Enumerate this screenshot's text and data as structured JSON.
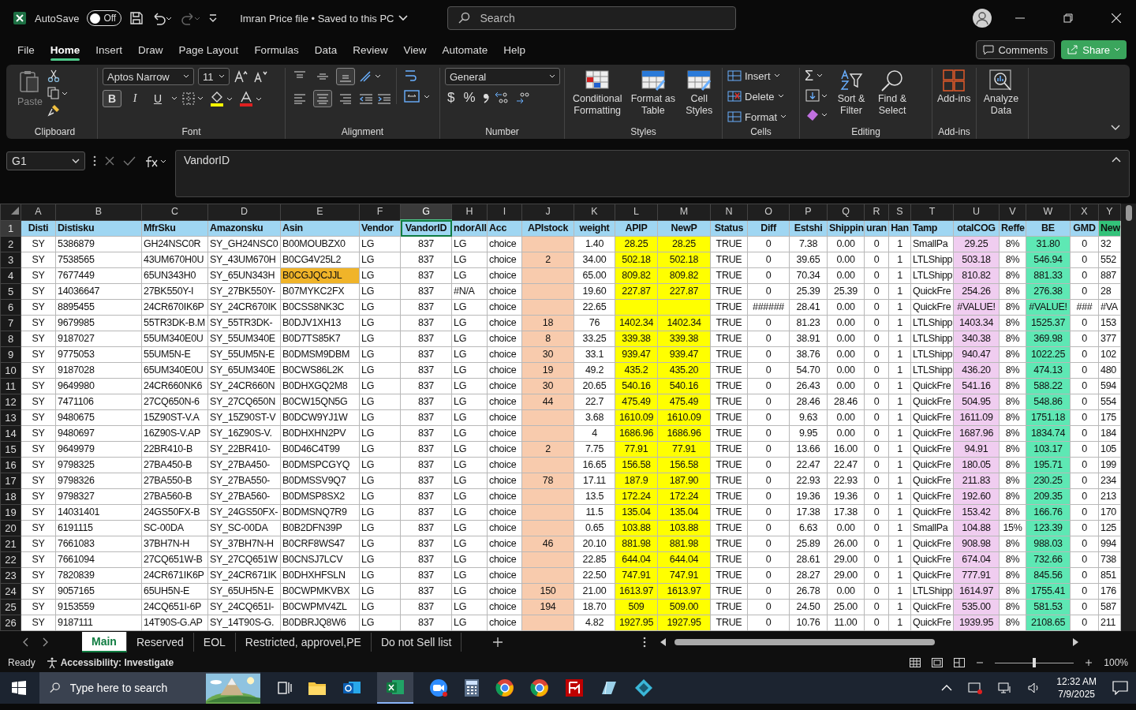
{
  "title_bar": {
    "autosave_label": "AutoSave",
    "autosave": {
      "on": false,
      "label": "Off"
    },
    "document_title": "Imran Price file • Saved to this PC",
    "search": {
      "placeholder": "Search"
    }
  },
  "menu_tabs": [
    {
      "label": "File",
      "selected": false
    },
    {
      "label": "Home",
      "selected": true
    },
    {
      "label": "Insert",
      "selected": false
    },
    {
      "label": "Draw",
      "selected": false
    },
    {
      "label": "Page Layout",
      "selected": false
    },
    {
      "label": "Formulas",
      "selected": false
    },
    {
      "label": "Data",
      "selected": false
    },
    {
      "label": "Review",
      "selected": false
    },
    {
      "label": "View",
      "selected": false
    },
    {
      "label": "Automate",
      "selected": false
    },
    {
      "label": "Help",
      "selected": false
    }
  ],
  "comments_label": "Comments",
  "share_label": "Share",
  "ribbon": [
    {
      "kind": "clipboard",
      "label": "Clipboard",
      "paste": "Paste"
    },
    {
      "kind": "font",
      "label": "Font",
      "font_name": "Aptos Narrow",
      "font_size": "11",
      "style_buttons": [
        {
          "label": "B",
          "selected": true
        },
        {
          "label": "I",
          "selected": false
        },
        {
          "label": "U",
          "selected": false
        }
      ]
    },
    {
      "kind": "alignment",
      "label": "Alignment",
      "vertical_align": [
        {
          "selected": false
        },
        {
          "selected": false
        },
        {
          "selected": true
        }
      ],
      "horizontal_align": [
        {
          "selected": false
        },
        {
          "selected": true
        },
        {
          "selected": false
        }
      ]
    },
    {
      "kind": "number",
      "label": "Number",
      "format": "General",
      "symbols": [
        "$",
        "%"
      ]
    },
    {
      "kind": "styles",
      "label": "Styles",
      "buttons": [
        "Conditional Formatting",
        "Format as Table",
        "Cell Styles"
      ]
    },
    {
      "kind": "cells",
      "label": "Cells",
      "buttons": [
        "Insert",
        "Delete",
        "Format"
      ]
    },
    {
      "kind": "editing",
      "label": "Editing",
      "symbol": "Σ",
      "buttons": [
        "Sort & Filter",
        "Find & Select"
      ]
    },
    {
      "kind": "addins",
      "label": "Add-ins",
      "buttons": [
        "Add-ins"
      ]
    },
    {
      "kind": "analyze",
      "buttons": [
        "Analyze Data"
      ]
    }
  ],
  "formula_bar": {
    "name_box": "G1",
    "formula": "VandorID"
  },
  "sheet": {
    "header_row_num": "1",
    "header_row": [
      {
        "text": "Disti"
      },
      {
        "text": "Distisku"
      },
      {
        "text": "MfrSku"
      },
      {
        "text": "Amazonsku"
      },
      {
        "text": "Asin"
      },
      {
        "text": "Vendor"
      },
      {
        "text": "VandorID"
      },
      {
        "text": "ndorAll"
      },
      {
        "text": "Acc"
      },
      {
        "text": "APIstock"
      },
      {
        "text": "weight"
      },
      {
        "text": "APIP"
      },
      {
        "text": "NewP"
      },
      {
        "text": "Status"
      },
      {
        "text": "Diff"
      },
      {
        "text": "Estshi"
      },
      {
        "text": "Shippin"
      },
      {
        "text": "uran"
      },
      {
        "text": "Han"
      },
      {
        "text": "Tamp"
      },
      {
        "text": "otalCOG"
      },
      {
        "text": "Reffe"
      },
      {
        "text": "BE"
      },
      {
        "text": "GMD"
      },
      {
        "text": "New",
        "color": "#33c27a"
      }
    ],
    "columns": [
      {
        "letter": "A",
        "selected": false
      },
      {
        "letter": "B",
        "selected": false
      },
      {
        "letter": "C",
        "selected": false
      },
      {
        "letter": "D",
        "selected": false
      },
      {
        "letter": "E",
        "selected": false
      },
      {
        "letter": "F",
        "selected": false
      },
      {
        "letter": "G",
        "selected": true
      },
      {
        "letter": "H",
        "selected": false
      },
      {
        "letter": "I",
        "selected": false
      },
      {
        "letter": "J",
        "selected": false,
        "color": "#f8cbad"
      },
      {
        "letter": "K",
        "selected": false
      },
      {
        "letter": "L",
        "selected": false,
        "color": "#ffff00"
      },
      {
        "letter": "M",
        "selected": false,
        "color": "#ffff00"
      },
      {
        "letter": "N",
        "selected": false
      },
      {
        "letter": "O",
        "selected": false
      },
      {
        "letter": "P",
        "selected": false
      },
      {
        "letter": "Q",
        "selected": false
      },
      {
        "letter": "R",
        "selected": false
      },
      {
        "letter": "S",
        "selected": false
      },
      {
        "letter": "T",
        "selected": false
      },
      {
        "letter": "U",
        "selected": false,
        "color": "#f0cdf0"
      },
      {
        "letter": "V",
        "selected": false
      },
      {
        "letter": "W",
        "selected": false,
        "color": "#5ee8b4"
      },
      {
        "letter": "X",
        "selected": false
      },
      {
        "letter": "Y",
        "selected": false
      }
    ],
    "rows": [
      {
        "num": "2",
        "asin_flagged": false,
        "cells": [
          "SY",
          "5386879",
          "GH24NSC0R",
          "SY_GH24NSC0",
          "B00MOUBZX0",
          "LG",
          "837",
          "LG",
          "choice",
          null,
          "1.40",
          "28.25",
          "28.25",
          "TRUE",
          "0",
          "7.38",
          "0.00",
          "0",
          "1",
          "SmallPa",
          "29.25",
          "8%",
          "31.80",
          "0",
          "32"
        ]
      },
      {
        "num": "3",
        "asin_flagged": false,
        "cells": [
          "SY",
          "7538565",
          "43UM670H0U",
          "SY_43UM670H",
          "B0CG4V25L2",
          "LG",
          "837",
          "LG",
          "choice",
          "2",
          "34.00",
          "502.18",
          "502.18",
          "TRUE",
          "0",
          "39.65",
          "0.00",
          "0",
          "1",
          "LTLShipp",
          "503.18",
          "8%",
          "546.94",
          "0",
          "552"
        ]
      },
      {
        "num": "4",
        "asin_flagged": true,
        "cells": [
          "SY",
          "7677449",
          "65UN343H0",
          "SY_65UN343H",
          "B0CGJQCJJL",
          "LG",
          "837",
          "LG",
          "choice",
          null,
          "65.00",
          "809.82",
          "809.82",
          "TRUE",
          "0",
          "70.34",
          "0.00",
          "0",
          "1",
          "LTLShipp",
          "810.82",
          "8%",
          "881.33",
          "0",
          "887"
        ]
      },
      {
        "num": "5",
        "asin_flagged": false,
        "cells": [
          "SY",
          "14036647",
          "27BK550Y-I",
          "SY_27BK550Y-",
          "B07MYKC2FX",
          "LG",
          "837",
          "#N/A",
          "choice",
          null,
          "19.60",
          "227.87",
          "227.87",
          "TRUE",
          "0",
          "25.39",
          "25.39",
          "0",
          "1",
          "QuickFre",
          "254.26",
          "8%",
          "276.38",
          "0",
          "28"
        ]
      },
      {
        "num": "6",
        "asin_flagged": false,
        "cells": [
          "SY",
          "8895455",
          "24CR670IK6P",
          "SY_24CR670IK",
          "B0CSS8NK3C",
          "LG",
          "837",
          "LG",
          "choice",
          null,
          "22.65",
          null,
          null,
          "TRUE",
          "######",
          "28.41",
          "0.00",
          "0",
          "1",
          "QuickFre",
          "#VALUE!",
          "8%",
          "#VALUE!",
          "###",
          "#VA"
        ]
      },
      {
        "num": "7",
        "asin_flagged": false,
        "cells": [
          "SY",
          "9679985",
          "55TR3DK-B.M",
          "SY_55TR3DK-",
          "B0DJV1XH13",
          "LG",
          "837",
          "LG",
          "choice",
          "18",
          "76",
          "1402.34",
          "1402.34",
          "TRUE",
          "0",
          "81.23",
          "0.00",
          "0",
          "1",
          "LTLShipp",
          "1403.34",
          "8%",
          "1525.37",
          "0",
          "153"
        ]
      },
      {
        "num": "8",
        "asin_flagged": false,
        "cells": [
          "SY",
          "9187027",
          "55UM340E0U",
          "SY_55UM340E",
          "B0D7TS85K7",
          "LG",
          "837",
          "LG",
          "choice",
          "8",
          "33.25",
          "339.38",
          "339.38",
          "TRUE",
          "0",
          "38.91",
          "0.00",
          "0",
          "1",
          "LTLShipp",
          "340.38",
          "8%",
          "369.98",
          "0",
          "377"
        ]
      },
      {
        "num": "9",
        "asin_flagged": false,
        "cells": [
          "SY",
          "9775053",
          "55UM5N-E",
          "SY_55UM5N-E",
          "B0DMSM9DBM",
          "LG",
          "837",
          "LG",
          "choice",
          "30",
          "33.1",
          "939.47",
          "939.47",
          "TRUE",
          "0",
          "38.76",
          "0.00",
          "0",
          "1",
          "LTLShipp",
          "940.47",
          "8%",
          "1022.25",
          "0",
          "102"
        ]
      },
      {
        "num": "10",
        "asin_flagged": false,
        "cells": [
          "SY",
          "9187028",
          "65UM340E0U",
          "SY_65UM340E",
          "B0CWS86L2K",
          "LG",
          "837",
          "LG",
          "choice",
          "19",
          "49.2",
          "435.2",
          "435.20",
          "TRUE",
          "0",
          "54.70",
          "0.00",
          "0",
          "1",
          "LTLShipp",
          "436.20",
          "8%",
          "474.13",
          "0",
          "480"
        ]
      },
      {
        "num": "11",
        "asin_flagged": false,
        "cells": [
          "SY",
          "9649980",
          "24CR660NK6",
          "SY_24CR660N",
          "B0DHXGQ2M8",
          "LG",
          "837",
          "LG",
          "choice",
          "30",
          "20.65",
          "540.16",
          "540.16",
          "TRUE",
          "0",
          "26.43",
          "0.00",
          "0",
          "1",
          "QuickFre",
          "541.16",
          "8%",
          "588.22",
          "0",
          "594"
        ]
      },
      {
        "num": "12",
        "asin_flagged": false,
        "cells": [
          "SY",
          "7471106",
          "27CQ650N-6",
          "SY_27CQ650N",
          "B0CW15QN5G",
          "LG",
          "837",
          "LG",
          "choice",
          "44",
          "22.7",
          "475.49",
          "475.49",
          "TRUE",
          "0",
          "28.46",
          "28.46",
          "0",
          "1",
          "QuickFre",
          "504.95",
          "8%",
          "548.86",
          "0",
          "554"
        ]
      },
      {
        "num": "13",
        "asin_flagged": false,
        "cells": [
          "SY",
          "9480675",
          "15Z90ST-V.A",
          "SY_15Z90ST-V",
          "B0DCW9YJ1W",
          "LG",
          "837",
          "LG",
          "choice",
          null,
          "3.68",
          "1610.09",
          "1610.09",
          "TRUE",
          "0",
          "9.63",
          "0.00",
          "0",
          "1",
          "QuickFre",
          "1611.09",
          "8%",
          "1751.18",
          "0",
          "175"
        ]
      },
      {
        "num": "14",
        "asin_flagged": false,
        "cells": [
          "SY",
          "9480697",
          "16Z90S-V.AP",
          "SY_16Z90S-V.",
          "B0DHXHN2PV",
          "LG",
          "837",
          "LG",
          "choice",
          null,
          "4",
          "1686.96",
          "1686.96",
          "TRUE",
          "0",
          "9.95",
          "0.00",
          "0",
          "1",
          "QuickFre",
          "1687.96",
          "8%",
          "1834.74",
          "0",
          "184"
        ]
      },
      {
        "num": "15",
        "asin_flagged": false,
        "cells": [
          "SY",
          "9649979",
          "22BR410-B",
          "SY_22BR410-",
          "B0D46C4T99",
          "LG",
          "837",
          "LG",
          "choice",
          "2",
          "7.75",
          "77.91",
          "77.91",
          "TRUE",
          "0",
          "13.66",
          "16.00",
          "0",
          "1",
          "QuickFre",
          "94.91",
          "8%",
          "103.17",
          "0",
          "105"
        ]
      },
      {
        "num": "16",
        "asin_flagged": false,
        "cells": [
          "SY",
          "9798325",
          "27BA450-B",
          "SY_27BA450-",
          "B0DMSPCGYQ",
          "LG",
          "837",
          "LG",
          "choice",
          null,
          "16.65",
          "156.58",
          "156.58",
          "TRUE",
          "0",
          "22.47",
          "22.47",
          "0",
          "1",
          "QuickFre",
          "180.05",
          "8%",
          "195.71",
          "0",
          "199"
        ]
      },
      {
        "num": "17",
        "asin_flagged": false,
        "cells": [
          "SY",
          "9798326",
          "27BA550-B",
          "SY_27BA550-",
          "B0DMSSV9Q7",
          "LG",
          "837",
          "LG",
          "choice",
          "78",
          "17.11",
          "187.9",
          "187.90",
          "TRUE",
          "0",
          "22.93",
          "22.93",
          "0",
          "1",
          "QuickFre",
          "211.83",
          "8%",
          "230.25",
          "0",
          "234"
        ]
      },
      {
        "num": "18",
        "asin_flagged": false,
        "cells": [
          "SY",
          "9798327",
          "27BA560-B",
          "SY_27BA560-",
          "B0DMSP8SX2",
          "LG",
          "837",
          "LG",
          "choice",
          null,
          "13.5",
          "172.24",
          "172.24",
          "TRUE",
          "0",
          "19.36",
          "19.36",
          "0",
          "1",
          "QuickFre",
          "192.60",
          "8%",
          "209.35",
          "0",
          "213"
        ]
      },
      {
        "num": "19",
        "asin_flagged": false,
        "cells": [
          "SY",
          "14031401",
          "24GS50FX-B",
          "SY_24GS50FX-",
          "B0DMSNQ7R9",
          "LG",
          "837",
          "LG",
          "choice",
          null,
          "11.5",
          "135.04",
          "135.04",
          "TRUE",
          "0",
          "17.38",
          "17.38",
          "0",
          "1",
          "QuickFre",
          "153.42",
          "8%",
          "166.76",
          "0",
          "170"
        ]
      },
      {
        "num": "20",
        "asin_flagged": false,
        "cells": [
          "SY",
          "6191115",
          "SC-00DA",
          "SY_SC-00DA",
          "B0B2DFN39P",
          "LG",
          "837",
          "LG",
          "choice",
          null,
          "0.65",
          "103.88",
          "103.88",
          "TRUE",
          "0",
          "6.63",
          "0.00",
          "0",
          "1",
          "SmallPa",
          "104.88",
          "15%",
          "123.39",
          "0",
          "125"
        ]
      },
      {
        "num": "21",
        "asin_flagged": false,
        "cells": [
          "SY",
          "7661083",
          "37BH7N-H",
          "SY_37BH7N-H",
          "B0CRF8WS47",
          "LG",
          "837",
          "LG",
          "choice",
          "46",
          "20.10",
          "881.98",
          "881.98",
          "TRUE",
          "0",
          "25.89",
          "26.00",
          "0",
          "1",
          "QuickFre",
          "908.98",
          "8%",
          "988.03",
          "0",
          "994"
        ]
      },
      {
        "num": "22",
        "asin_flagged": false,
        "cells": [
          "SY",
          "7661094",
          "27CQ651W-B",
          "SY_27CQ651W",
          "B0CNSJ7LCV",
          "LG",
          "837",
          "LG",
          "choice",
          null,
          "22.85",
          "644.04",
          "644.04",
          "TRUE",
          "0",
          "28.61",
          "29.00",
          "0",
          "1",
          "QuickFre",
          "674.04",
          "8%",
          "732.66",
          "0",
          "738"
        ]
      },
      {
        "num": "23",
        "asin_flagged": false,
        "cells": [
          "SY",
          "7820839",
          "24CR671IK6P",
          "SY_24CR671IK",
          "B0DHXHFSLN",
          "LG",
          "837",
          "LG",
          "choice",
          null,
          "22.50",
          "747.91",
          "747.91",
          "TRUE",
          "0",
          "28.27",
          "29.00",
          "0",
          "1",
          "QuickFre",
          "777.91",
          "8%",
          "845.56",
          "0",
          "851"
        ]
      },
      {
        "num": "24",
        "asin_flagged": false,
        "cells": [
          "SY",
          "9057165",
          "65UH5N-E",
          "SY_65UH5N-E",
          "B0CWPMKVBX",
          "LG",
          "837",
          "LG",
          "choice",
          "150",
          "21.00",
          "1613.97",
          "1613.97",
          "TRUE",
          "0",
          "26.78",
          "0.00",
          "0",
          "1",
          "LTLShipp",
          "1614.97",
          "8%",
          "1755.41",
          "0",
          "176"
        ]
      },
      {
        "num": "25",
        "asin_flagged": false,
        "cells": [
          "SY",
          "9153559",
          "24CQ651I-6P",
          "SY_24CQ651I-",
          "B0CWPMV4ZL",
          "LG",
          "837",
          "LG",
          "choice",
          "194",
          "18.70",
          "509",
          "509.00",
          "TRUE",
          "0",
          "24.50",
          "25.00",
          "0",
          "1",
          "QuickFre",
          "535.00",
          "8%",
          "581.53",
          "0",
          "587"
        ]
      },
      {
        "num": "26",
        "asin_flagged": false,
        "cells": [
          "SY",
          "9187111",
          "14T90S-G.AP",
          "SY_14T90S-G.",
          "B0DBRJQ8W6",
          "LG",
          "837",
          "LG",
          "choice",
          null,
          "4.82",
          "1927.95",
          "1927.95",
          "TRUE",
          "0",
          "10.76",
          "11.00",
          "0",
          "1",
          "QuickFre",
          "1939.95",
          "8%",
          "2108.65",
          "0",
          "211"
        ]
      }
    ]
  },
  "sheet_tabs": [
    {
      "label": "Main",
      "selected": true
    },
    {
      "label": "Reserved",
      "selected": false
    },
    {
      "label": "EOL",
      "selected": false
    },
    {
      "label": "Restricted, approvel,PE",
      "selected": false
    },
    {
      "label": "Do not Sell list",
      "selected": false
    }
  ],
  "status_bar": {
    "ready": "Ready",
    "accessibility": "Accessibility: Investigate",
    "zoom": {
      "level": 0.5,
      "label": "100%"
    }
  },
  "taskbar": {
    "search": {
      "placeholder": "Type here to search"
    },
    "time": "12:32 AM",
    "date": "7/9/2025"
  }
}
